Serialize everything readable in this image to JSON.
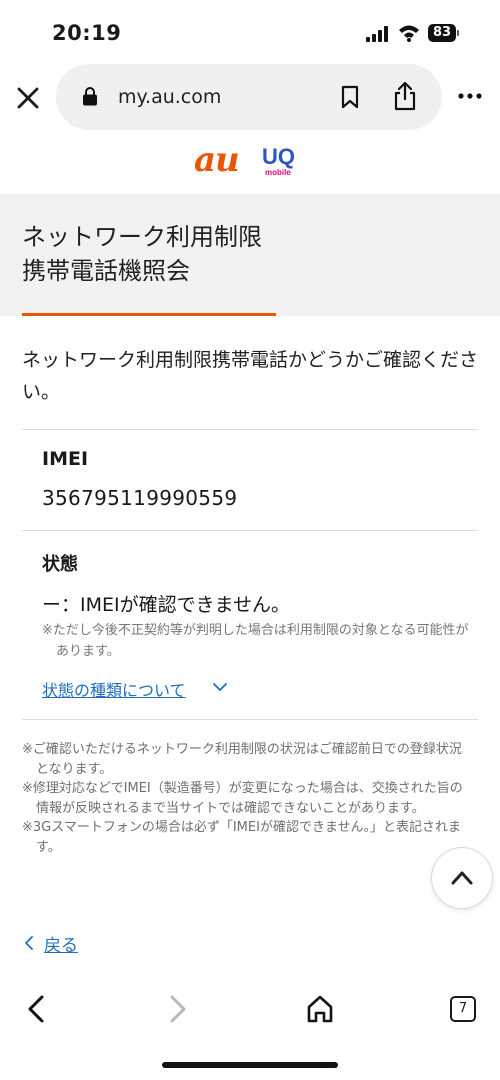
{
  "status_bar": {
    "time": "20:19",
    "battery": "83"
  },
  "browser": {
    "url": "my.au.com",
    "icons": [
      "close-icon",
      "lock-icon",
      "bookmark-icon",
      "share-icon",
      "more-icon"
    ]
  },
  "logo": {
    "brand_au": "au",
    "brand_uq": "UQ",
    "brand_uq_sub": "mobile"
  },
  "colors": {
    "accent": "#eb5505",
    "link": "#1f6fbe",
    "header_bg": "#f2f2f2"
  },
  "page": {
    "title_line1": "ネットワーク利用制限",
    "title_line2": "携帯電話機照会",
    "intro": "ネットワーク利用制限携帯電話かどうかご確認ください。"
  },
  "result": {
    "imei_label": "IMEI",
    "imei_value": "356795119990559",
    "status_label": "状態",
    "status_value": "ー：IMEIが確認できません。",
    "status_note": "※ただし今後不正契約等が判明した場合は利用制限の対象となる可能性があります。",
    "status_link": "状態の種類について"
  },
  "footnotes": [
    "※ご確認いただけるネットワーク利用制限の状況はご確認前日での登録状況となります。",
    "※修理対応などでIMEI（製造番号）が変更になった場合は、交換された旨の情報が反映されるまで当サイトでは確認できないことがあります。",
    "※3Gスマートフォンの場合は必ず「IMEIが確認できません。」と表記されます。"
  ],
  "back_link": "戻る",
  "toolbar": {
    "tab_count": "7"
  }
}
